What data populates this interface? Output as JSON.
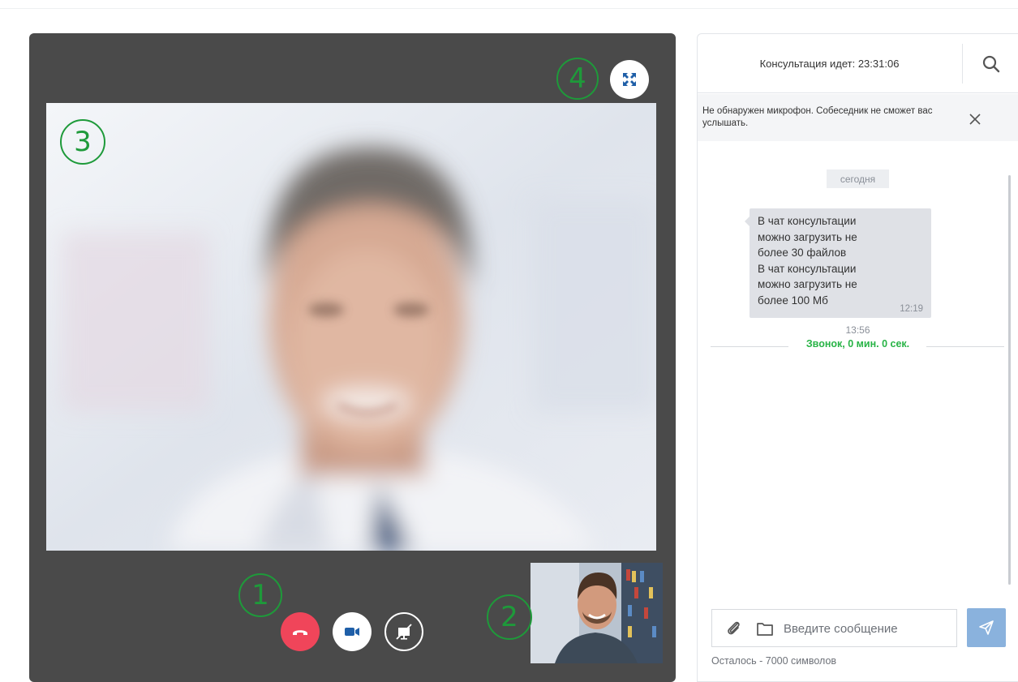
{
  "video": {
    "markers": [
      "1",
      "2",
      "3",
      "4"
    ],
    "icons": {
      "fullscreen": "expand-arrows-icon",
      "hangup": "phone-hangup-icon",
      "camera": "video-camera-icon",
      "screen_share": "screen-share-off-icon"
    },
    "colors": {
      "panel": "#4a4a4a",
      "hangup": "#f0455a",
      "camera_icon": "#1f5fa8",
      "marker": "#1e9a3a"
    }
  },
  "chat": {
    "header": {
      "status": "Консультация идет: 23:31:06",
      "search_icon": "search-icon"
    },
    "mic_warning": {
      "text": "Не обнаружен микрофон. Собеседник не сможет вас услышать.",
      "close_icon": "close-icon"
    },
    "date_badge": "сегодня",
    "messages": [
      {
        "lines": [
          "В чат консультации",
          "можно загрузить не",
          "более 30 файлов",
          "В чат консультации",
          "можно загрузить не",
          "более 100 Мб"
        ],
        "time": "12:19"
      }
    ],
    "call_event": {
      "time": "13:56",
      "label": "Звонок, 0 мин. 0 сек.",
      "color": "#28b446"
    },
    "composer": {
      "placeholder": "Введите сообщение",
      "value": "",
      "attach_icon": "paperclip-icon",
      "folder_icon": "folder-icon",
      "send_icon": "send-icon"
    },
    "char_counter": "Осталось - 7000 символов",
    "colors": {
      "send": "#8ab2dd",
      "bubble": "#dfe1e6"
    }
  }
}
